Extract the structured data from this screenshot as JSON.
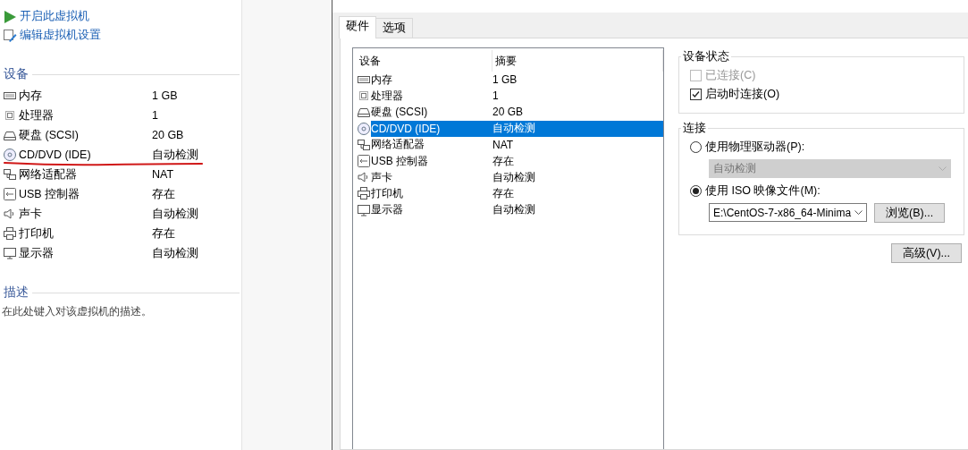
{
  "sidebar": {
    "actions": [
      {
        "kind": "power-on",
        "label": "开启此虚拟机"
      },
      {
        "kind": "edit",
        "label": "编辑虚拟机设置"
      }
    ],
    "devices_heading": "设备",
    "devices": [
      {
        "kind": "memory",
        "name": "内存",
        "value": "1 GB",
        "underlined": false
      },
      {
        "kind": "cpu",
        "name": "处理器",
        "value": "1",
        "underlined": false
      },
      {
        "kind": "disk",
        "name": "硬盘 (SCSI)",
        "value": "20 GB",
        "underlined": false
      },
      {
        "kind": "cd",
        "name": "CD/DVD (IDE)",
        "value": "自动检测",
        "underlined": true
      },
      {
        "kind": "network",
        "name": "网络适配器",
        "value": "NAT",
        "underlined": false
      },
      {
        "kind": "usb",
        "name": "USB 控制器",
        "value": "存在",
        "underlined": false
      },
      {
        "kind": "sound",
        "name": "声卡",
        "value": "自动检测",
        "underlined": false
      },
      {
        "kind": "printer",
        "name": "打印机",
        "value": "存在",
        "underlined": false
      },
      {
        "kind": "display",
        "name": "显示器",
        "value": "自动检测",
        "underlined": false
      }
    ],
    "description_heading": "描述",
    "description": {
      "placeholder": "在此处键入对该虚拟机的描述。"
    }
  },
  "dialog": {
    "tabs": [
      {
        "label": "硬件",
        "selected": true
      },
      {
        "label": "选项",
        "selected": false
      }
    ],
    "table": {
      "columns": [
        "设备",
        "摘要"
      ],
      "rows": [
        {
          "kind": "memory",
          "device": "内存",
          "summary": "1 GB",
          "selected": false
        },
        {
          "kind": "cpu",
          "device": "处理器",
          "summary": "1",
          "selected": false
        },
        {
          "kind": "disk",
          "device": "硬盘 (SCSI)",
          "summary": "20 GB",
          "selected": false
        },
        {
          "kind": "cd",
          "device": "CD/DVD (IDE)",
          "summary": "自动检测",
          "selected": true
        },
        {
          "kind": "network",
          "device": "网络适配器",
          "summary": "NAT",
          "selected": false
        },
        {
          "kind": "usb",
          "device": "USB 控制器",
          "summary": "存在",
          "selected": false
        },
        {
          "kind": "sound",
          "device": "声卡",
          "summary": "自动检测",
          "selected": false
        },
        {
          "kind": "printer",
          "device": "打印机",
          "summary": "存在",
          "selected": false
        },
        {
          "kind": "display",
          "device": "显示器",
          "summary": "自动检测",
          "selected": false
        }
      ]
    },
    "device_status": {
      "title": "设备状态",
      "options": [
        {
          "label": "已连接(C)",
          "checked": false,
          "disabled": true
        },
        {
          "label": "启动时连接(O)",
          "checked": true,
          "disabled": false
        }
      ]
    },
    "connection": {
      "title": "连接",
      "options": [
        {
          "label": "使用物理驱动器(P):",
          "selected": false,
          "dropdown": {
            "value": "自动检测",
            "disabled": true
          }
        },
        {
          "label": "使用 ISO 映像文件(M):",
          "selected": true,
          "dropdown": {
            "value": "E:\\CentOS-7-x86_64-Minima",
            "disabled": false
          },
          "button": "浏览(B)..."
        }
      ]
    },
    "advanced_button": "高级(V)..."
  }
}
